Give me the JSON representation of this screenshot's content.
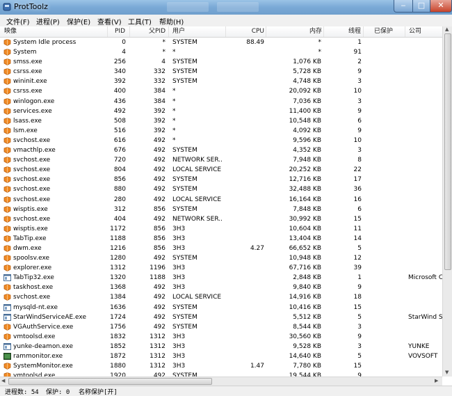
{
  "window": {
    "title": "ProtToolz"
  },
  "colors": {
    "titlebar": "#7aa9d6",
    "menubar": "#f0f0f0",
    "close": "#c7432a"
  },
  "menu": [
    "文件(F)",
    "进程(P)",
    "保护(E)",
    "查看(V)",
    "工具(T)",
    "帮助(H)"
  ],
  "columns": [
    "映像",
    "PID",
    "父PID",
    "用户",
    "CPU",
    "内存",
    "线程",
    "已保护",
    "公司"
  ],
  "rows": [
    {
      "name": "System Idle process",
      "pid": "0",
      "ppid": "*",
      "user": "SYSTEM",
      "cpu": "88.49",
      "mem": "*",
      "threads": "1",
      "protected": "",
      "company": "",
      "icon": "process-icon"
    },
    {
      "name": "System",
      "pid": "4",
      "ppid": "*",
      "user": "*",
      "cpu": "",
      "mem": "*",
      "threads": "91",
      "protected": "",
      "company": "",
      "icon": "process-icon"
    },
    {
      "name": "smss.exe",
      "pid": "256",
      "ppid": "4",
      "user": "SYSTEM",
      "cpu": "",
      "mem": "1,076 KB",
      "threads": "2",
      "protected": "",
      "company": "",
      "icon": "process-icon"
    },
    {
      "name": "csrss.exe",
      "pid": "340",
      "ppid": "332",
      "user": "SYSTEM",
      "cpu": "",
      "mem": "5,728 KB",
      "threads": "9",
      "protected": "",
      "company": "",
      "icon": "process-icon"
    },
    {
      "name": "wininit.exe",
      "pid": "392",
      "ppid": "332",
      "user": "SYSTEM",
      "cpu": "",
      "mem": "4,748 KB",
      "threads": "3",
      "protected": "",
      "company": "",
      "icon": "process-icon"
    },
    {
      "name": "csrss.exe",
      "pid": "400",
      "ppid": "384",
      "user": "*",
      "cpu": "",
      "mem": "20,092 KB",
      "threads": "10",
      "protected": "",
      "company": "",
      "icon": "process-icon"
    },
    {
      "name": "winlogon.exe",
      "pid": "436",
      "ppid": "384",
      "user": "*",
      "cpu": "",
      "mem": "7,036 KB",
      "threads": "3",
      "protected": "",
      "company": "",
      "icon": "process-icon"
    },
    {
      "name": "services.exe",
      "pid": "492",
      "ppid": "392",
      "user": "*",
      "cpu": "",
      "mem": "11,400 KB",
      "threads": "9",
      "protected": "",
      "company": "",
      "icon": "process-icon"
    },
    {
      "name": "lsass.exe",
      "pid": "508",
      "ppid": "392",
      "user": "*",
      "cpu": "",
      "mem": "10,548 KB",
      "threads": "6",
      "protected": "",
      "company": "",
      "icon": "process-icon"
    },
    {
      "name": "lsm.exe",
      "pid": "516",
      "ppid": "392",
      "user": "*",
      "cpu": "",
      "mem": "4,092 KB",
      "threads": "9",
      "protected": "",
      "company": "",
      "icon": "process-icon"
    },
    {
      "name": "svchost.exe",
      "pid": "616",
      "ppid": "492",
      "user": "*",
      "cpu": "",
      "mem": "9,596 KB",
      "threads": "10",
      "protected": "",
      "company": "",
      "icon": "process-icon"
    },
    {
      "name": "vmacthlp.exe",
      "pid": "676",
      "ppid": "492",
      "user": "SYSTEM",
      "cpu": "",
      "mem": "4,352 KB",
      "threads": "3",
      "protected": "",
      "company": "",
      "icon": "process-icon"
    },
    {
      "name": "svchost.exe",
      "pid": "720",
      "ppid": "492",
      "user": "NETWORK SER...",
      "cpu": "",
      "mem": "7,948 KB",
      "threads": "8",
      "protected": "",
      "company": "",
      "icon": "process-icon"
    },
    {
      "name": "svchost.exe",
      "pid": "804",
      "ppid": "492",
      "user": "LOCAL SERVICE",
      "cpu": "",
      "mem": "20,252 KB",
      "threads": "22",
      "protected": "",
      "company": "",
      "icon": "process-icon"
    },
    {
      "name": "svchost.exe",
      "pid": "856",
      "ppid": "492",
      "user": "SYSTEM",
      "cpu": "",
      "mem": "12,716 KB",
      "threads": "17",
      "protected": "",
      "company": "",
      "icon": "process-icon"
    },
    {
      "name": "svchost.exe",
      "pid": "880",
      "ppid": "492",
      "user": "SYSTEM",
      "cpu": "",
      "mem": "32,488 KB",
      "threads": "36",
      "protected": "",
      "company": "",
      "icon": "process-icon"
    },
    {
      "name": "svchost.exe",
      "pid": "280",
      "ppid": "492",
      "user": "LOCAL SERVICE",
      "cpu": "",
      "mem": "16,164 KB",
      "threads": "16",
      "protected": "",
      "company": "",
      "icon": "process-icon"
    },
    {
      "name": "wisptis.exe",
      "pid": "312",
      "ppid": "856",
      "user": "SYSTEM",
      "cpu": "",
      "mem": "7,848 KB",
      "threads": "6",
      "protected": "",
      "company": "",
      "icon": "process-icon"
    },
    {
      "name": "svchost.exe",
      "pid": "404",
      "ppid": "492",
      "user": "NETWORK SER...",
      "cpu": "",
      "mem": "30,992 KB",
      "threads": "15",
      "protected": "",
      "company": "",
      "icon": "process-icon"
    },
    {
      "name": "wisptis.exe",
      "pid": "1172",
      "ppid": "856",
      "user": "3H3",
      "cpu": "",
      "mem": "10,604 KB",
      "threads": "11",
      "protected": "",
      "company": "",
      "icon": "process-icon"
    },
    {
      "name": "TabTip.exe",
      "pid": "1188",
      "ppid": "856",
      "user": "3H3",
      "cpu": "",
      "mem": "13,404 KB",
      "threads": "14",
      "protected": "",
      "company": "",
      "icon": "process-icon"
    },
    {
      "name": "dwm.exe",
      "pid": "1216",
      "ppid": "856",
      "user": "3H3",
      "cpu": "4.27",
      "mem": "66,652 KB",
      "threads": "5",
      "protected": "",
      "company": "",
      "icon": "process-icon"
    },
    {
      "name": "spoolsv.exe",
      "pid": "1280",
      "ppid": "492",
      "user": "SYSTEM",
      "cpu": "",
      "mem": "10,948 KB",
      "threads": "12",
      "protected": "",
      "company": "",
      "icon": "process-icon"
    },
    {
      "name": "explorer.exe",
      "pid": "1312",
      "ppid": "1196",
      "user": "3H3",
      "cpu": "",
      "mem": "67,716 KB",
      "threads": "39",
      "protected": "",
      "company": "",
      "icon": "process-icon"
    },
    {
      "name": "TabTip32.exe",
      "pid": "1320",
      "ppid": "1188",
      "user": "3H3",
      "cpu": "",
      "mem": "2,848 KB",
      "threads": "1",
      "protected": "",
      "company": "Microsoft Cor",
      "icon": "app-window-icon"
    },
    {
      "name": "taskhost.exe",
      "pid": "1368",
      "ppid": "492",
      "user": "3H3",
      "cpu": "",
      "mem": "9,840 KB",
      "threads": "9",
      "protected": "",
      "company": "",
      "icon": "process-icon"
    },
    {
      "name": "svchost.exe",
      "pid": "1384",
      "ppid": "492",
      "user": "LOCAL SERVICE",
      "cpu": "",
      "mem": "14,916 KB",
      "threads": "18",
      "protected": "",
      "company": "",
      "icon": "process-icon"
    },
    {
      "name": "mysqld-nt.exe",
      "pid": "1636",
      "ppid": "492",
      "user": "SYSTEM",
      "cpu": "",
      "mem": "10,416 KB",
      "threads": "15",
      "protected": "",
      "company": "",
      "icon": "app-window-icon"
    },
    {
      "name": "StarWindServiceAE.exe",
      "pid": "1724",
      "ppid": "492",
      "user": "SYSTEM",
      "cpu": "",
      "mem": "5,512 KB",
      "threads": "5",
      "protected": "",
      "company": "StarWind Sof",
      "icon": "app-window-icon"
    },
    {
      "name": "VGAuthService.exe",
      "pid": "1756",
      "ppid": "492",
      "user": "SYSTEM",
      "cpu": "",
      "mem": "8,544 KB",
      "threads": "3",
      "protected": "",
      "company": "",
      "icon": "process-icon"
    },
    {
      "name": "vmtoolsd.exe",
      "pid": "1832",
      "ppid": "1312",
      "user": "3H3",
      "cpu": "",
      "mem": "30,560 KB",
      "threads": "9",
      "protected": "",
      "company": "",
      "icon": "process-icon"
    },
    {
      "name": "yunke-deamon.exe",
      "pid": "1852",
      "ppid": "1312",
      "user": "3H3",
      "cpu": "",
      "mem": "9,528 KB",
      "threads": "3",
      "protected": "",
      "company": "YUNKE",
      "icon": "app-window-icon"
    },
    {
      "name": "rammonitor.exe",
      "pid": "1872",
      "ppid": "1312",
      "user": "3H3",
      "cpu": "",
      "mem": "14,640 KB",
      "threads": "5",
      "protected": "",
      "company": "VOVSOFT",
      "icon": "monitor-icon"
    },
    {
      "name": "SystemMonitor.exe",
      "pid": "1880",
      "ppid": "1312",
      "user": "3H3",
      "cpu": "1.47",
      "mem": "7,780 KB",
      "threads": "15",
      "protected": "",
      "company": "",
      "icon": "process-icon"
    },
    {
      "name": "vmtoolsd.exe",
      "pid": "1920",
      "ppid": "492",
      "user": "SYSTEM",
      "cpu": "",
      "mem": "19,544 KB",
      "threads": "9",
      "protected": "",
      "company": "",
      "icon": "process-icon"
    }
  ],
  "status": {
    "process_count": "进程数: 54",
    "protected": "保护: 0",
    "name_protect": "名称保护[开]"
  }
}
